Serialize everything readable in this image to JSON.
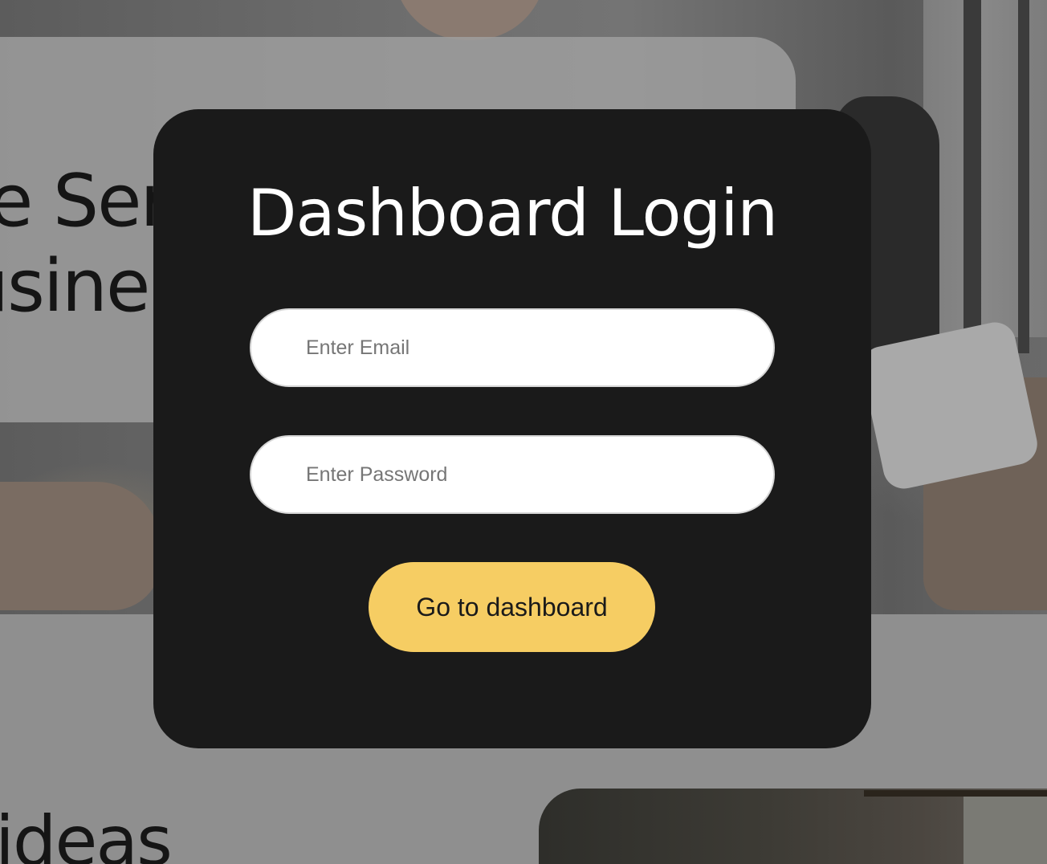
{
  "hero": {
    "heading_line1": "e Ser",
    "heading_line2": "usine"
  },
  "lower": {
    "heading": "ideas"
  },
  "login": {
    "title": "Dashboard Login",
    "email_placeholder": "Enter Email",
    "password_placeholder": "Enter Password",
    "submit_label": "Go to dashboard"
  },
  "colors": {
    "modal_background": "#1a1a1a",
    "accent_button": "#f6cd63",
    "overlay": "#8f8f8f"
  }
}
